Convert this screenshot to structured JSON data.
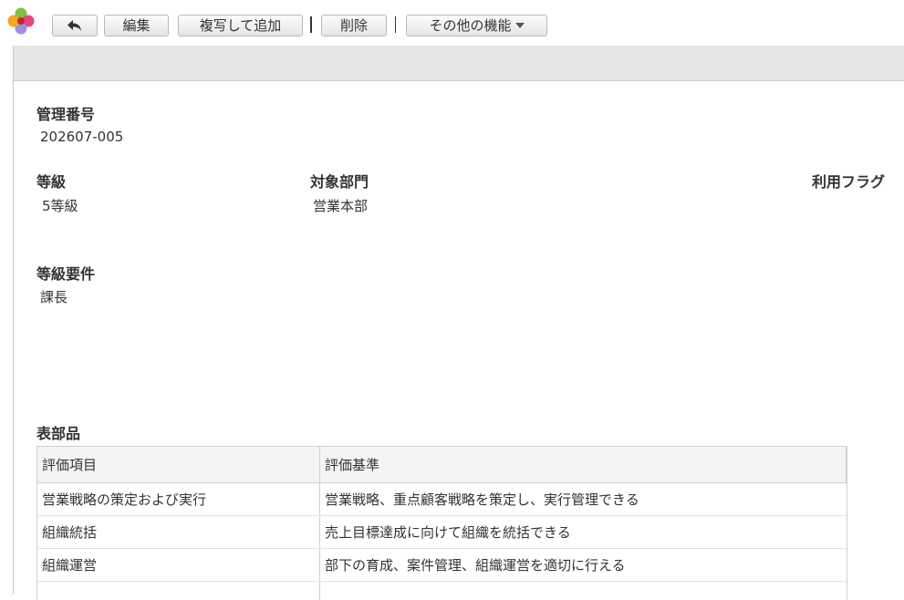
{
  "toolbar": {
    "back_label": "",
    "edit_label": "編集",
    "copy_add_label": "複写して追加",
    "delete_label": "削除",
    "more_label": "その他の機能"
  },
  "fields": {
    "management_no": {
      "label": "管理番号",
      "value": "202607-005"
    },
    "grade": {
      "label": "等級",
      "value": "5等級"
    },
    "department": {
      "label": "対象部門",
      "value": "営業本部"
    },
    "usage_flag": {
      "label": "利用フラグ",
      "value": ""
    },
    "grade_requirement": {
      "label": "等級要件",
      "value": "課長"
    }
  },
  "table": {
    "title": "表部品",
    "columns": [
      "評価項目",
      "評価基準"
    ],
    "rows": [
      [
        "営業戦略の策定および実行",
        "営業戦略、重点顧客戦略を策定し、実行管理できる"
      ],
      [
        "組織統括",
        "売上目標達成に向けて組織を統括できる"
      ],
      [
        "組織運営",
        "部下の育成、案件管理、組織運営を適切に行える"
      ]
    ]
  },
  "icons": {
    "logo": "app-logo-icon",
    "back": "back-arrow-icon",
    "more_caret": "caret-down-icon"
  },
  "colors": {
    "logo_orange": "#f5a623",
    "logo_green": "#7cc142",
    "logo_pink": "#e8467c",
    "logo_purple": "#9b8ee6",
    "logo_center": "#c0262d",
    "panel_bar": "#e5e5e5"
  }
}
